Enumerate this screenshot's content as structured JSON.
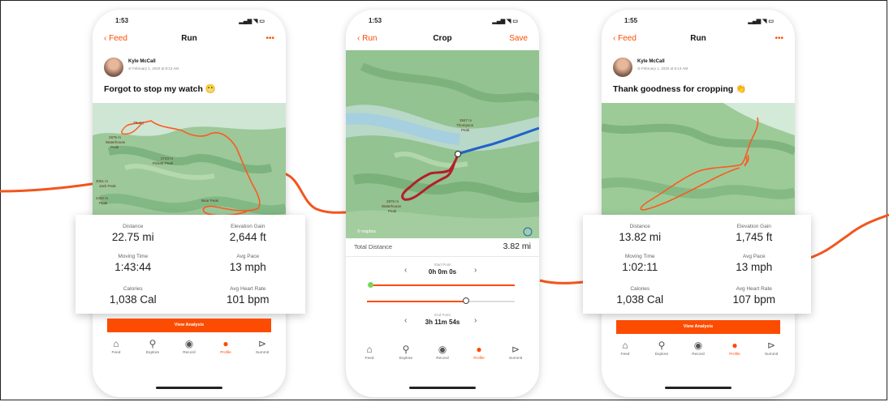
{
  "colors": {
    "accent": "#fc4c02",
    "route_light": "#fc5a20",
    "route_dark": "#b3202a",
    "route_blue": "#1f63c9"
  },
  "phone1": {
    "time": "1:53",
    "nav": {
      "back": "Feed",
      "title": "Run",
      "more": "•••"
    },
    "user": {
      "name": "Kyle McCall",
      "date": "February 1, 2020 at 8:13 AM"
    },
    "headline": "Forgot to stop my watch 😬",
    "map_labels": [
      "Thung",
      "2875 m",
      "Waterhouse",
      "Peak",
      "2743 m",
      "Pickett Peak",
      "3061 m",
      "Jack Peak",
      "Bear Peak",
      "2462 m",
      "Peak"
    ],
    "stats": [
      {
        "label": "Distance",
        "value": "22.75 mi"
      },
      {
        "label": "Elevation Gain",
        "value": "2,644 ft"
      },
      {
        "label": "Moving Time",
        "value": "1:43:44"
      },
      {
        "label": "Avg Pace",
        "value": "13 mph"
      },
      {
        "label": "Calories",
        "value": "1,038 Cal"
      },
      {
        "label": "Avg Heart Rate",
        "value": "101 bpm"
      }
    ],
    "button": "View Analysis"
  },
  "phone2": {
    "time": "1:53",
    "nav": {
      "back": "Run",
      "title": "Crop",
      "save": "Save"
    },
    "map_labels": [
      "2847 m",
      "Thompson",
      "Peak",
      "2875 m",
      "Waterhouse",
      "Peak"
    ],
    "map_credit": "© mapbox",
    "total_distance_label": "Total Distance",
    "total_distance_value": "3.82 mi",
    "start_label": "Start Point",
    "start_value": "0h 0m 0s",
    "end_label": "End Point",
    "end_value": "3h 11m 54s",
    "start_fraction": 0.0,
    "end_fraction": 0.67
  },
  "phone3": {
    "time": "1:55",
    "nav": {
      "back": "Feed",
      "title": "Run",
      "more": "•••"
    },
    "user": {
      "name": "Kyle McCall",
      "date": "February 1, 2020 at 8:13 AM"
    },
    "headline": "Thank goodness for cropping 👏",
    "stats": [
      {
        "label": "Distance",
        "value": "13.82 mi"
      },
      {
        "label": "Elevation Gain",
        "value": "1,745 ft"
      },
      {
        "label": "Moving Time",
        "value": "1:02:11"
      },
      {
        "label": "Avg Pace",
        "value": "13 mph"
      },
      {
        "label": "Calories",
        "value": "1,038 Cal"
      },
      {
        "label": "Avg Heart Rate",
        "value": "107 bpm"
      }
    ],
    "button": "View Analysis"
  },
  "tabs": [
    {
      "label": "Feed",
      "icon": "home-icon"
    },
    {
      "label": "Explore",
      "icon": "search-icon"
    },
    {
      "label": "Record",
      "icon": "record-icon"
    },
    {
      "label": "Profile",
      "icon": "profile-icon",
      "active": true
    },
    {
      "label": "Summit",
      "icon": "summit-icon"
    }
  ]
}
